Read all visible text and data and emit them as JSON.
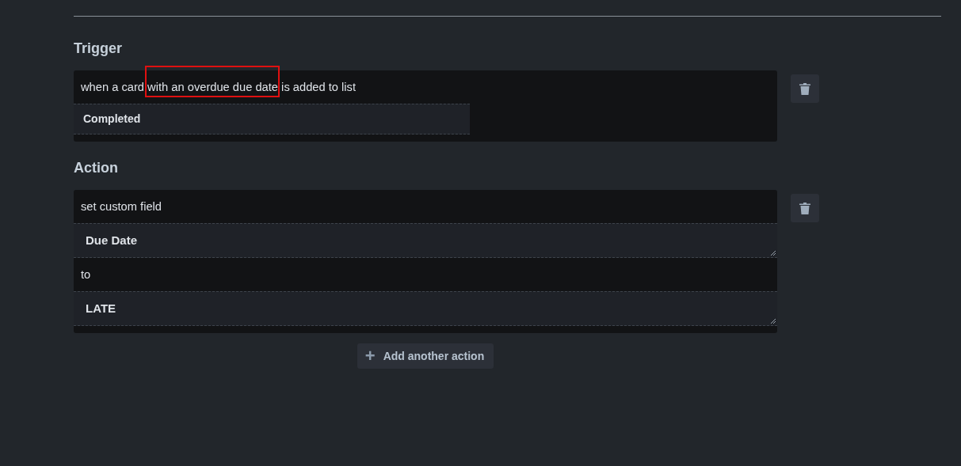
{
  "sections": [
    {
      "heading": "Trigger",
      "rows": [
        {
          "kind": "text",
          "text": "when a card with an overdue due date is added to list",
          "highlighted": true
        },
        {
          "kind": "select",
          "value": "Completed"
        }
      ]
    },
    {
      "heading": "Action",
      "rows": [
        {
          "kind": "text",
          "text": "set custom field"
        },
        {
          "kind": "textarea",
          "value": "Due Date"
        },
        {
          "kind": "text",
          "text": "to"
        },
        {
          "kind": "textarea",
          "value": "LATE"
        }
      ]
    }
  ],
  "add_button": {
    "icon": "+",
    "label": "Add another action"
  }
}
